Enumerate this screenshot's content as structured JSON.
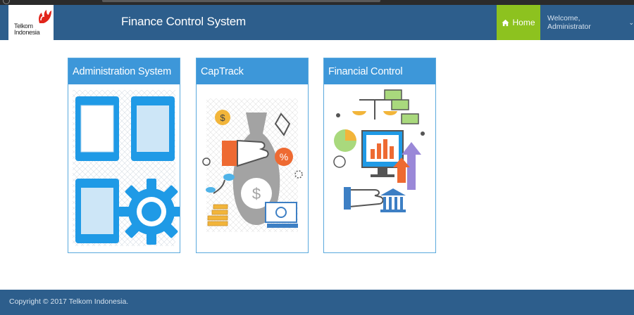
{
  "browser": {},
  "navbar": {
    "logo": {
      "line1": "Telkom",
      "line2": "Indonesia"
    },
    "app_title": "Finance Control System",
    "home_label": "Home",
    "user_greeting": "Welcome, Administrator",
    "colors": {
      "bar": "#2d5e8c",
      "home": "#8dc21f"
    }
  },
  "cards": [
    {
      "title": "Administration System",
      "icon": "admin-tiles-gear-icon"
    },
    {
      "title": "CapTrack",
      "icon": "money-bag-hand-icon"
    },
    {
      "title": "Financial Control",
      "icon": "finance-monitor-chart-icon"
    }
  ],
  "footer": {
    "copyright": "Copyright © 2017 Telkom Indonesia."
  },
  "colors": {
    "card_header": "#3d97d9",
    "card_border": "#5aa9dd"
  }
}
